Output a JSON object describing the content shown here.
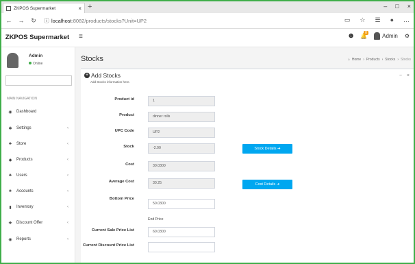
{
  "browser": {
    "tab_title": "ZKPOS Supermarket",
    "tab_close": "×",
    "new_tab": "+",
    "url_host": "localhost",
    "url_path": ":8082/products/stocks?Unit=UP2",
    "window": {
      "minimize": "–",
      "maximize": "□",
      "close": "×"
    }
  },
  "header": {
    "logo": "ZKPOS Supermarket",
    "menu_icon": "≡",
    "notification_count": "8",
    "user_name": "Admin"
  },
  "sidebar": {
    "user_name": "Admin",
    "status": "Online",
    "nav_heading": "MAIN NAVIGATION",
    "items": [
      {
        "label": "Dashboard",
        "icon": "◉",
        "arrow": ""
      },
      {
        "label": "Settings",
        "icon": "✱",
        "arrow": "‹"
      },
      {
        "label": "Store",
        "icon": "♣",
        "arrow": "‹"
      },
      {
        "label": "Products",
        "icon": "◆",
        "arrow": "‹"
      },
      {
        "label": "Users",
        "icon": "♣",
        "arrow": "‹"
      },
      {
        "label": "Accounts",
        "icon": "♣",
        "arrow": "‹"
      },
      {
        "label": "Inventory",
        "icon": "▮",
        "arrow": "‹"
      },
      {
        "label": "Discount Offer",
        "icon": "✚",
        "arrow": "‹"
      },
      {
        "label": "Reports",
        "icon": "◉",
        "arrow": "‹"
      }
    ]
  },
  "main": {
    "page_title": "Stocks",
    "breadcrumb": [
      "Home",
      "Products",
      "Stocks",
      "Stocks"
    ],
    "box_title": "Add Stocks",
    "box_subtitle": "Add Stocks information here.",
    "tools": {
      "collapse": "−",
      "close": "×"
    },
    "fields": {
      "product_id": {
        "label": "Product id",
        "value": "1"
      },
      "product": {
        "label": "Product",
        "value": "dinner rolls"
      },
      "upc_code": {
        "label": "UPC Code",
        "value": "UP2"
      },
      "stock": {
        "label": "Stock",
        "value": "-2.00"
      },
      "cost": {
        "label": "Cost",
        "value": "30.0300"
      },
      "average_cost": {
        "label": "Average Cost",
        "value": "30.25"
      },
      "bottom_price": {
        "label": "Bottom Price",
        "value": "50.0300"
      },
      "end_price": {
        "label": "End Price"
      },
      "current_sale_price_list": {
        "label": "Current Sale Price List",
        "value": "60.0300"
      },
      "current_discount_price_list": {
        "label": "Current Discount Price List",
        "value": ""
      }
    },
    "buttons": {
      "stock_details": "Stock Details ➔",
      "cost_details": "Cost Details ➔"
    }
  }
}
